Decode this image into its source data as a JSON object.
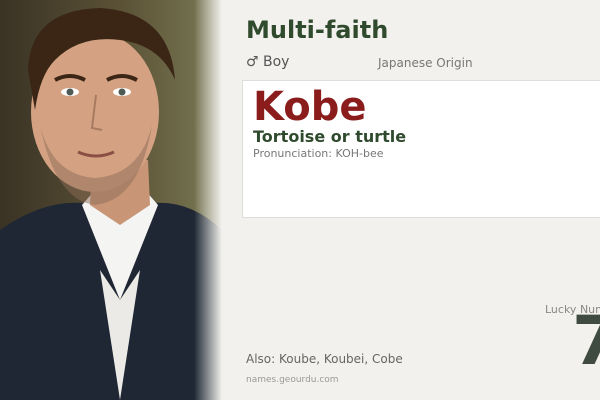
{
  "header": {
    "title": "Multi-faith",
    "gender": "♂ Boy",
    "origin": "Japanese Origin"
  },
  "name_card": {
    "name": "Kobe",
    "meaning": "Tortoise or turtle",
    "pronunciation": "Pronunciation: KOH-bee"
  },
  "lucky": {
    "label": "Lucky Num",
    "number": "7"
  },
  "footer": {
    "also": "Also: Koube, Koubei, Cobe",
    "site": "names.geourdu.com"
  },
  "colors": {
    "background": "#f2f1ed",
    "name": "#8a1c1c",
    "heading": "#2f4a2c"
  }
}
